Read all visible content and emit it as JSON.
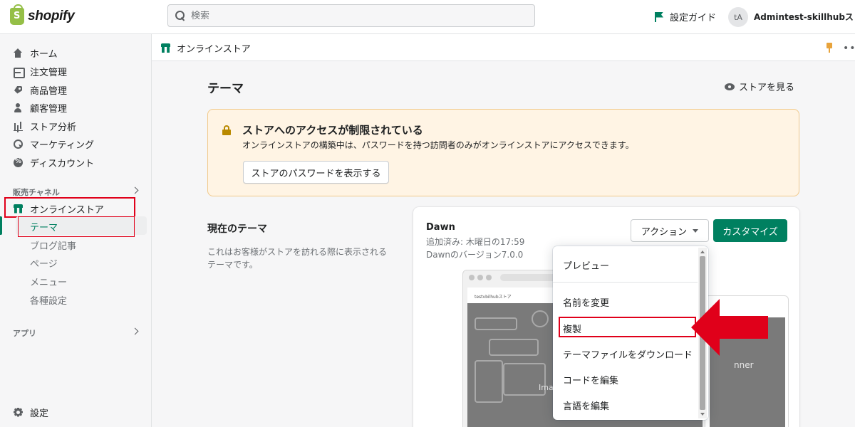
{
  "topbar": {
    "logo_text": "shopify",
    "search_placeholder": "検索",
    "setup_guide": "設定ガイド",
    "avatar_initials": "tA",
    "account_name": "Admintest-skillhubスト..."
  },
  "sidebar": {
    "items": [
      {
        "label": "ホーム",
        "icon": "home-icon"
      },
      {
        "label": "注文管理",
        "icon": "order-icon"
      },
      {
        "label": "商品管理",
        "icon": "tag-icon"
      },
      {
        "label": "顧客管理",
        "icon": "person-icon"
      },
      {
        "label": "ストア分析",
        "icon": "chart-icon"
      },
      {
        "label": "マーケティング",
        "icon": "target-icon"
      },
      {
        "label": "ディスカウント",
        "icon": "discount-icon"
      }
    ],
    "sales_channels_label": "販売チャネル",
    "online_store": "オンラインストア",
    "sub_items": [
      "テーマ",
      "ブログ記事",
      "ページ",
      "メニュー",
      "各種設定"
    ],
    "apps_label": "アプリ",
    "settings": "設定"
  },
  "breadcrumb": {
    "label": "オンラインストア",
    "more": "•••"
  },
  "main": {
    "title": "テーマ",
    "view_store": "ストアを見る",
    "banner": {
      "title": "ストアへのアクセスが制限されている",
      "text": "オンラインストアの構築中は、パスワードを持つ訪問者のみがオンラインストアにアクセスできます。",
      "button": "ストアのパスワードを表示する"
    },
    "current_theme": {
      "section_title": "現在のテーマ",
      "section_desc": "これはお客様がストアを訪れる際に表示されるテーマです。",
      "name": "Dawn",
      "added": "追加済み: 木曜日の17:59",
      "version": "Dawnのバージョン7.0.0",
      "action_button": "アクション",
      "customize_button": "カスタマイズ",
      "preview_nav": "testvbilhubストア",
      "preview_hero_text": "Imag",
      "mobile_hero_text": "nner"
    },
    "action_menu": [
      "プレビュー",
      "名前を変更",
      "複製",
      "テーマファイルをダウンロード",
      "コードを編集",
      "言語を編集"
    ]
  },
  "colors": {
    "brand_green": "#008060",
    "highlight_red": "#e0001a",
    "banner_bg": "#fff4e4"
  }
}
